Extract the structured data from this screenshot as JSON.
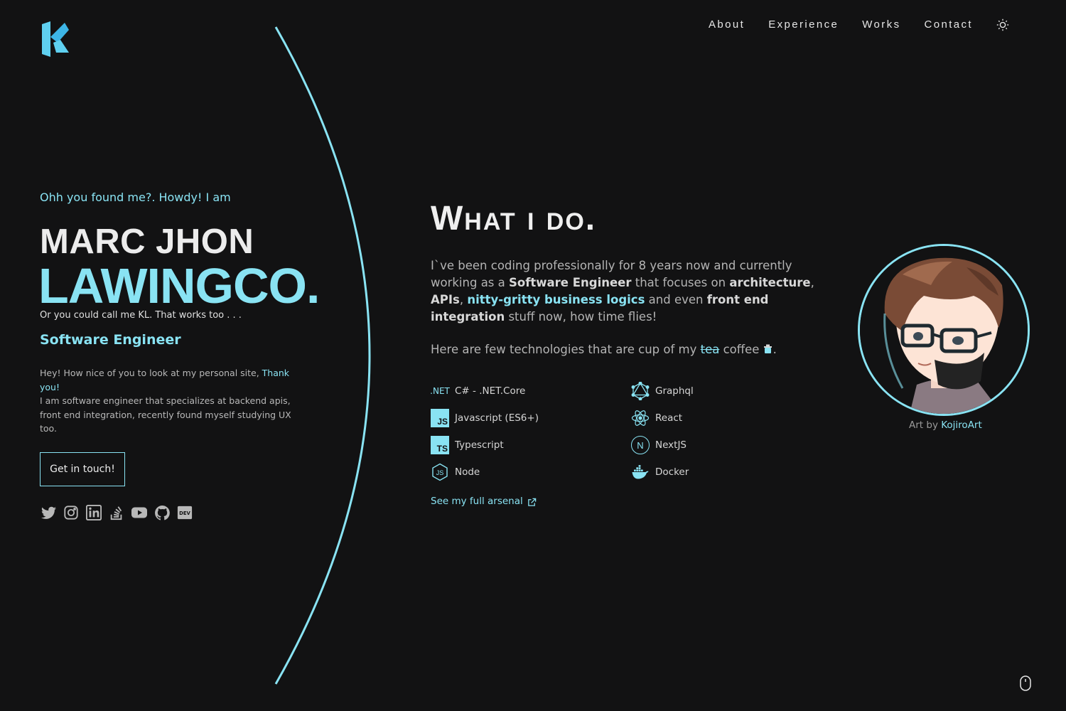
{
  "nav": {
    "items": [
      {
        "label": "About"
      },
      {
        "label": "Experience"
      },
      {
        "label": "Works"
      },
      {
        "label": "Contact"
      }
    ],
    "theme_icon": "sun-icon"
  },
  "hero": {
    "greeting": "Ohh you found me?. Howdy! I am",
    "first_name": "MARC JHON",
    "last_name": "LAWINGCO.",
    "nickname": "Or you could call me KL. That works too . . .",
    "role": "Software Engineer",
    "intro_a": "Hey! How nice of you to look at my personal site, ",
    "intro_link": "Thank you!",
    "intro_b": "I am software engineer that specializes at backend apis, front end integration, recently found myself studying UX too.",
    "cta": "Get in touch!",
    "socials": [
      "twitter-icon",
      "instagram-icon",
      "linkedin-icon",
      "stackoverflow-icon",
      "youtube-icon",
      "github-icon",
      "dev-icon"
    ]
  },
  "whatido": {
    "title": "What i do.",
    "p1_a": "`ve been coding professionally for 8 years now and currently working as a ",
    "p1_b": "Software Engineer",
    "p1_c": " that focuses on ",
    "p1_d": "architecture",
    "p1_e": ", ",
    "p1_f": "APIs",
    "p1_g": ", ",
    "p1_h": "nitty-gritty business logics",
    "p1_i": " and even ",
    "p1_j": "front end integration",
    "p1_k": " stuff now, how time flies!",
    "p1_start": "I",
    "p2_a": "Here are few technologies that are cup of my ",
    "p2_strike": "tea",
    "p2_b": " coffee ",
    "p2_end": ".",
    "tech": [
      {
        "label": "C# - .NET.Core",
        "icon": "dotnet-icon",
        "icon_text": ".NET"
      },
      {
        "label": "Graphql",
        "icon": "graphql-icon"
      },
      {
        "label": "Javascript (ES6+)",
        "icon": "javascript-icon",
        "icon_text": "JS"
      },
      {
        "label": "React",
        "icon": "react-icon"
      },
      {
        "label": "Typescript",
        "icon": "typescript-icon",
        "icon_text": "TS"
      },
      {
        "label": "NextJS",
        "icon": "nextjs-icon",
        "icon_text": "N"
      },
      {
        "label": "Node",
        "icon": "nodejs-icon",
        "icon_text": "JS"
      },
      {
        "label": "Docker",
        "icon": "docker-icon"
      }
    ],
    "arsenal_link": "See my full arsenal"
  },
  "avatar": {
    "credit_prefix": "Art by ",
    "credit_name": "KojiroArt"
  },
  "colors": {
    "accent": "#89e3f3",
    "background": "#121213"
  }
}
